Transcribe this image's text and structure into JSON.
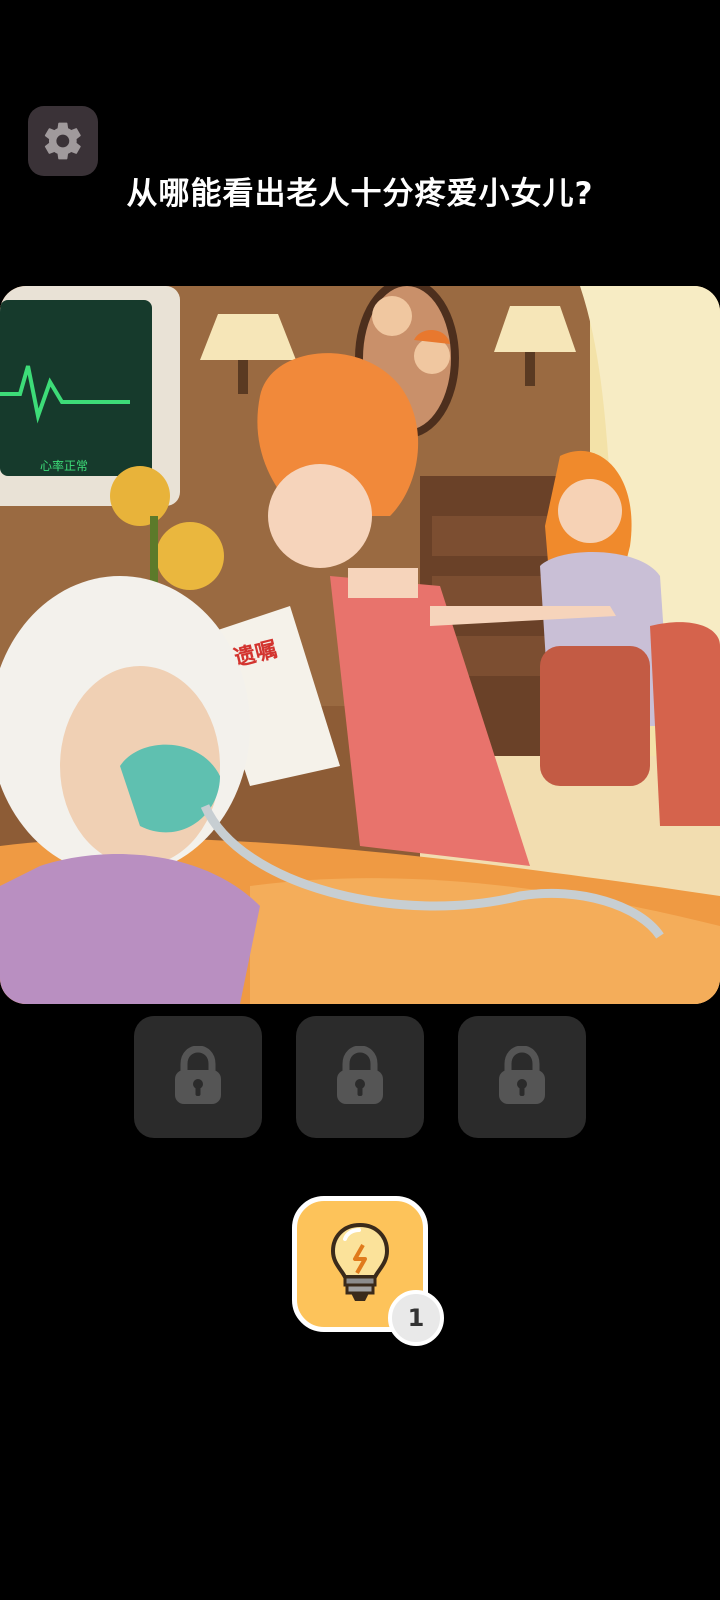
{
  "question": "从哪能看出老人十分疼爱小女儿?",
  "scene": {
    "will_text": "遗嘱",
    "monitor_text": "心率正常"
  },
  "answer_slots": [
    {
      "state": "locked",
      "icon": "lock-icon"
    },
    {
      "state": "locked",
      "icon": "lock-icon"
    },
    {
      "state": "locked",
      "icon": "lock-icon"
    }
  ],
  "hint": {
    "icon": "lightbulb-icon",
    "count": "1"
  },
  "colors": {
    "background": "#000000",
    "hint_button": "#fdc35a",
    "slot": "#2b2b2b"
  }
}
